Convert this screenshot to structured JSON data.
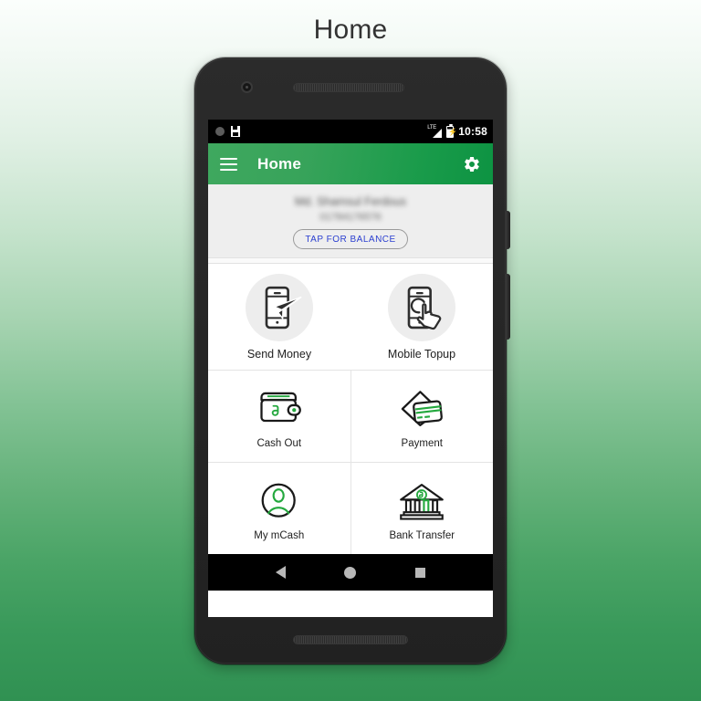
{
  "page": {
    "title": "Home",
    "background_top": "#fbfefc",
    "background_bottom": "#309152"
  },
  "device": {
    "type": "android-phone",
    "camera": "front-camera",
    "speaker": "earpiece-speaker",
    "buttons": [
      "power-button",
      "volume-button"
    ]
  },
  "status_bar": {
    "notification_icons": [
      "circle-notification-icon",
      "save-notification-icon"
    ],
    "network_label": "LTE",
    "signal_icon": "signal-bars-icon",
    "battery_icon": "battery-charging-icon",
    "time": "10:58"
  },
  "app_bar": {
    "menu_icon": "hamburger-menu-icon",
    "title": "Home",
    "settings_icon": "gear-icon",
    "color_start": "#3fa85f",
    "color_end": "#0d9342"
  },
  "profile": {
    "name": "Md. Shamsul Ferdous",
    "phone": "01784176576",
    "blurred": true,
    "balance_button_label": "TAP FOR BALANCE",
    "balance_button_color": "#2b3fd0"
  },
  "hero_actions": [
    {
      "label": "Send Money",
      "icon": "phone-paper-plane-icon"
    },
    {
      "label": "Mobile Topup",
      "icon": "phone-tap-hand-icon"
    }
  ],
  "grid_actions": [
    {
      "label": "Cash Out",
      "icon": "wallet-taka-icon"
    },
    {
      "label": "Payment",
      "icon": "card-envelope-icon"
    },
    {
      "label": "My mCash",
      "icon": "user-circle-icon"
    },
    {
      "label": "Bank Transfer",
      "icon": "bank-taka-icon"
    }
  ],
  "nav_bar": {
    "back": "back-triangle-icon",
    "home": "home-circle-icon",
    "recents": "recents-square-icon"
  },
  "accent": {
    "green": "#23a455",
    "dark": "#262626"
  }
}
